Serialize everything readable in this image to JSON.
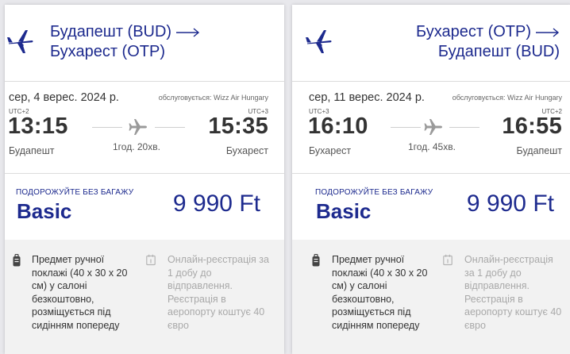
{
  "colors": {
    "brand": "#1d2a8e",
    "text": "#333333",
    "muted": "#a9a9a9"
  },
  "flights": [
    {
      "route_from": "Будапешт (BUD)",
      "route_to": "Бухарест (OTP)",
      "date": "сер, 4 верес. 2024 р.",
      "operated_by": "обслуговується: Wizz Air Hungary",
      "dep_utc": "UTC+2",
      "arr_utc": "UTC+3",
      "dep_time": "13:15",
      "arr_time": "15:35",
      "dep_city": "Будапешт",
      "arr_city": "Бухарест",
      "duration": "1год. 20хв.",
      "fare_tagline": "ПОДОРОЖУЙТЕ БЕЗ БАГАЖУ",
      "fare_name": "Basic",
      "price": "9 990 Ft",
      "included": "Предмет ручної поклажі (40 х 30 х 20 см) у салоні безкоштовно, розміщується під сидінням попереду",
      "checkin": "Онлайн-реєстрація за 1 добу до відправлення. Реєстрація в аеропорту коштує 40 євро",
      "icons": {
        "logo": "airplane-logo-icon",
        "arrow": "arrow-right-icon",
        "flight": "airplane-icon",
        "bag": "cabin-bag-icon",
        "checkin": "calendar-checkin-icon"
      }
    },
    {
      "route_from": "Бухарест (OTP)",
      "route_to": "Будапешт (BUD)",
      "date": "сер, 11 верес. 2024 р.",
      "operated_by": "обслуговується: Wizz Air Hungary",
      "dep_utc": "UTC+3",
      "arr_utc": "UTC+2",
      "dep_time": "16:10",
      "arr_time": "16:55",
      "dep_city": "Бухарест",
      "arr_city": "Будапешт",
      "duration": "1год. 45хв.",
      "fare_tagline": "ПОДОРОЖУЙТЕ БЕЗ БАГАЖУ",
      "fare_name": "Basic",
      "price": "9 990 Ft",
      "included": "Предмет ручної поклажі (40 х 30 х 20 см) у салоні безкоштовно, розміщується під сидінням попереду",
      "checkin": "Онлайн-реєстрація за 1 добу до відправлення. Реєстрація в аеропорту коштує 40 євро",
      "icons": {
        "logo": "airplane-logo-icon",
        "arrow": "arrow-right-icon",
        "flight": "airplane-icon",
        "bag": "cabin-bag-icon",
        "checkin": "calendar-checkin-icon"
      }
    }
  ]
}
